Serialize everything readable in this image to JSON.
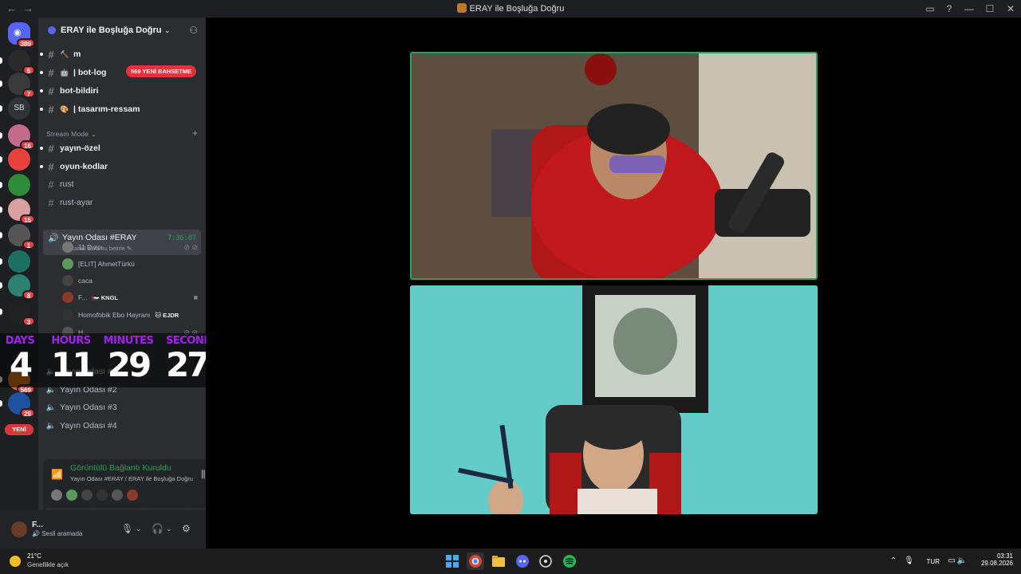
{
  "window": {
    "title": "ERAY ile Boşluğa Doğru",
    "nav_back": "←",
    "nav_forward": "→"
  },
  "server_rail": {
    "home_badge": "389",
    "items": [
      {
        "label": "",
        "badge": "5",
        "color": "#2a2a2a"
      },
      {
        "label": "",
        "badge": "7",
        "color": "#3a3a3a"
      },
      {
        "label": "SB",
        "badge": "",
        "color": "#313338"
      },
      {
        "label": "",
        "badge": "16",
        "color": "#c26c8a"
      },
      {
        "label": "",
        "badge": "",
        "color": "#e8403a"
      },
      {
        "label": "",
        "badge": "",
        "color": "#2f8a3a"
      },
      {
        "label": "",
        "badge": "15",
        "color": "#d8a0a0"
      },
      {
        "label": "",
        "badge": "1",
        "color": "#555"
      },
      {
        "label": "",
        "badge": "",
        "color": "#1f6e62"
      },
      {
        "label": "",
        "badge": "8",
        "color": "#2e8070"
      },
      {
        "label": "",
        "badge": "3",
        "color": "#222"
      },
      {
        "label": "",
        "badge": "569",
        "color": "#d06a20"
      },
      {
        "label": "",
        "badge": "29",
        "color": "#2050a0"
      }
    ],
    "new_pill": "YENİ"
  },
  "guild": {
    "name": "ERAY ile Boşluğa Doğru",
    "mention_pill": "569 YENİ BAHSETME"
  },
  "channels_top": [
    {
      "name": "m",
      "emoji": "🔨",
      "unread": true
    },
    {
      "name": "| bot-log",
      "emoji": "🤖",
      "unread": true
    },
    {
      "name": "bot-bildiri",
      "emoji": "",
      "unread": true
    },
    {
      "name": "| tasarım-ressam",
      "emoji": "🎨",
      "unread": true
    }
  ],
  "category": {
    "name": "Stream Mode",
    "add": "+"
  },
  "channels_stream": [
    {
      "name": "yayın-özel",
      "unread": true
    },
    {
      "name": "oyun-kodlar",
      "unread": true
    },
    {
      "name": "rust",
      "unread": false
    },
    {
      "name": "rust-ayar",
      "unread": false
    }
  ],
  "voice_active": {
    "name": "Yayın Odası #ERAY",
    "timer": "7:36:07",
    "status": "Bir kanal durumu belirle"
  },
  "voice_users": [
    {
      "name": "11 Dızcı",
      "tag": "",
      "color": "#777"
    },
    {
      "name": "[ELIT] AhmetTürkü",
      "tag": "",
      "color": "#5a9a5a"
    },
    {
      "name": "caca",
      "tag": "",
      "color": "#444"
    },
    {
      "name": "F...",
      "tag": "🇵🇸 KNGL",
      "color": "#8a3a2a"
    },
    {
      "name": "Homofobik Ebo Hayranı",
      "tag": "🐱 EJDR",
      "color": "#333"
    },
    {
      "name": "H...",
      "tag": "",
      "color": "#555"
    }
  ],
  "countdown": {
    "days_label": "DAYS",
    "days": "4",
    "hours_label": "HOURS",
    "hours": "11",
    "minutes_label": "MINUTES",
    "minutes": "29",
    "seconds_label": "SECONDS",
    "seconds": "27"
  },
  "voice_channels": [
    {
      "name": "Yayın Odası #1"
    },
    {
      "name": "Yayın Odası #2"
    },
    {
      "name": "Yayın Odası #3"
    },
    {
      "name": "Yayın Odası #4"
    }
  ],
  "voice_connection": {
    "status": "Görüntülü Bağlantı Kuruldu",
    "sub": "Yayın Odası #ERAY / ERAY ile Boşluğa Doğru"
  },
  "user_panel": {
    "name": "F...",
    "status": "Sesli aramada"
  },
  "taskbar": {
    "temp": "21°C",
    "condition": "Genellikle açık",
    "lang": "TUR",
    "time": "03:31",
    "date": "29.08.2026"
  },
  "colors": {
    "accent_green": "#23a55a",
    "mention_red": "#da373c",
    "countdown_purple": "#a020f0"
  }
}
